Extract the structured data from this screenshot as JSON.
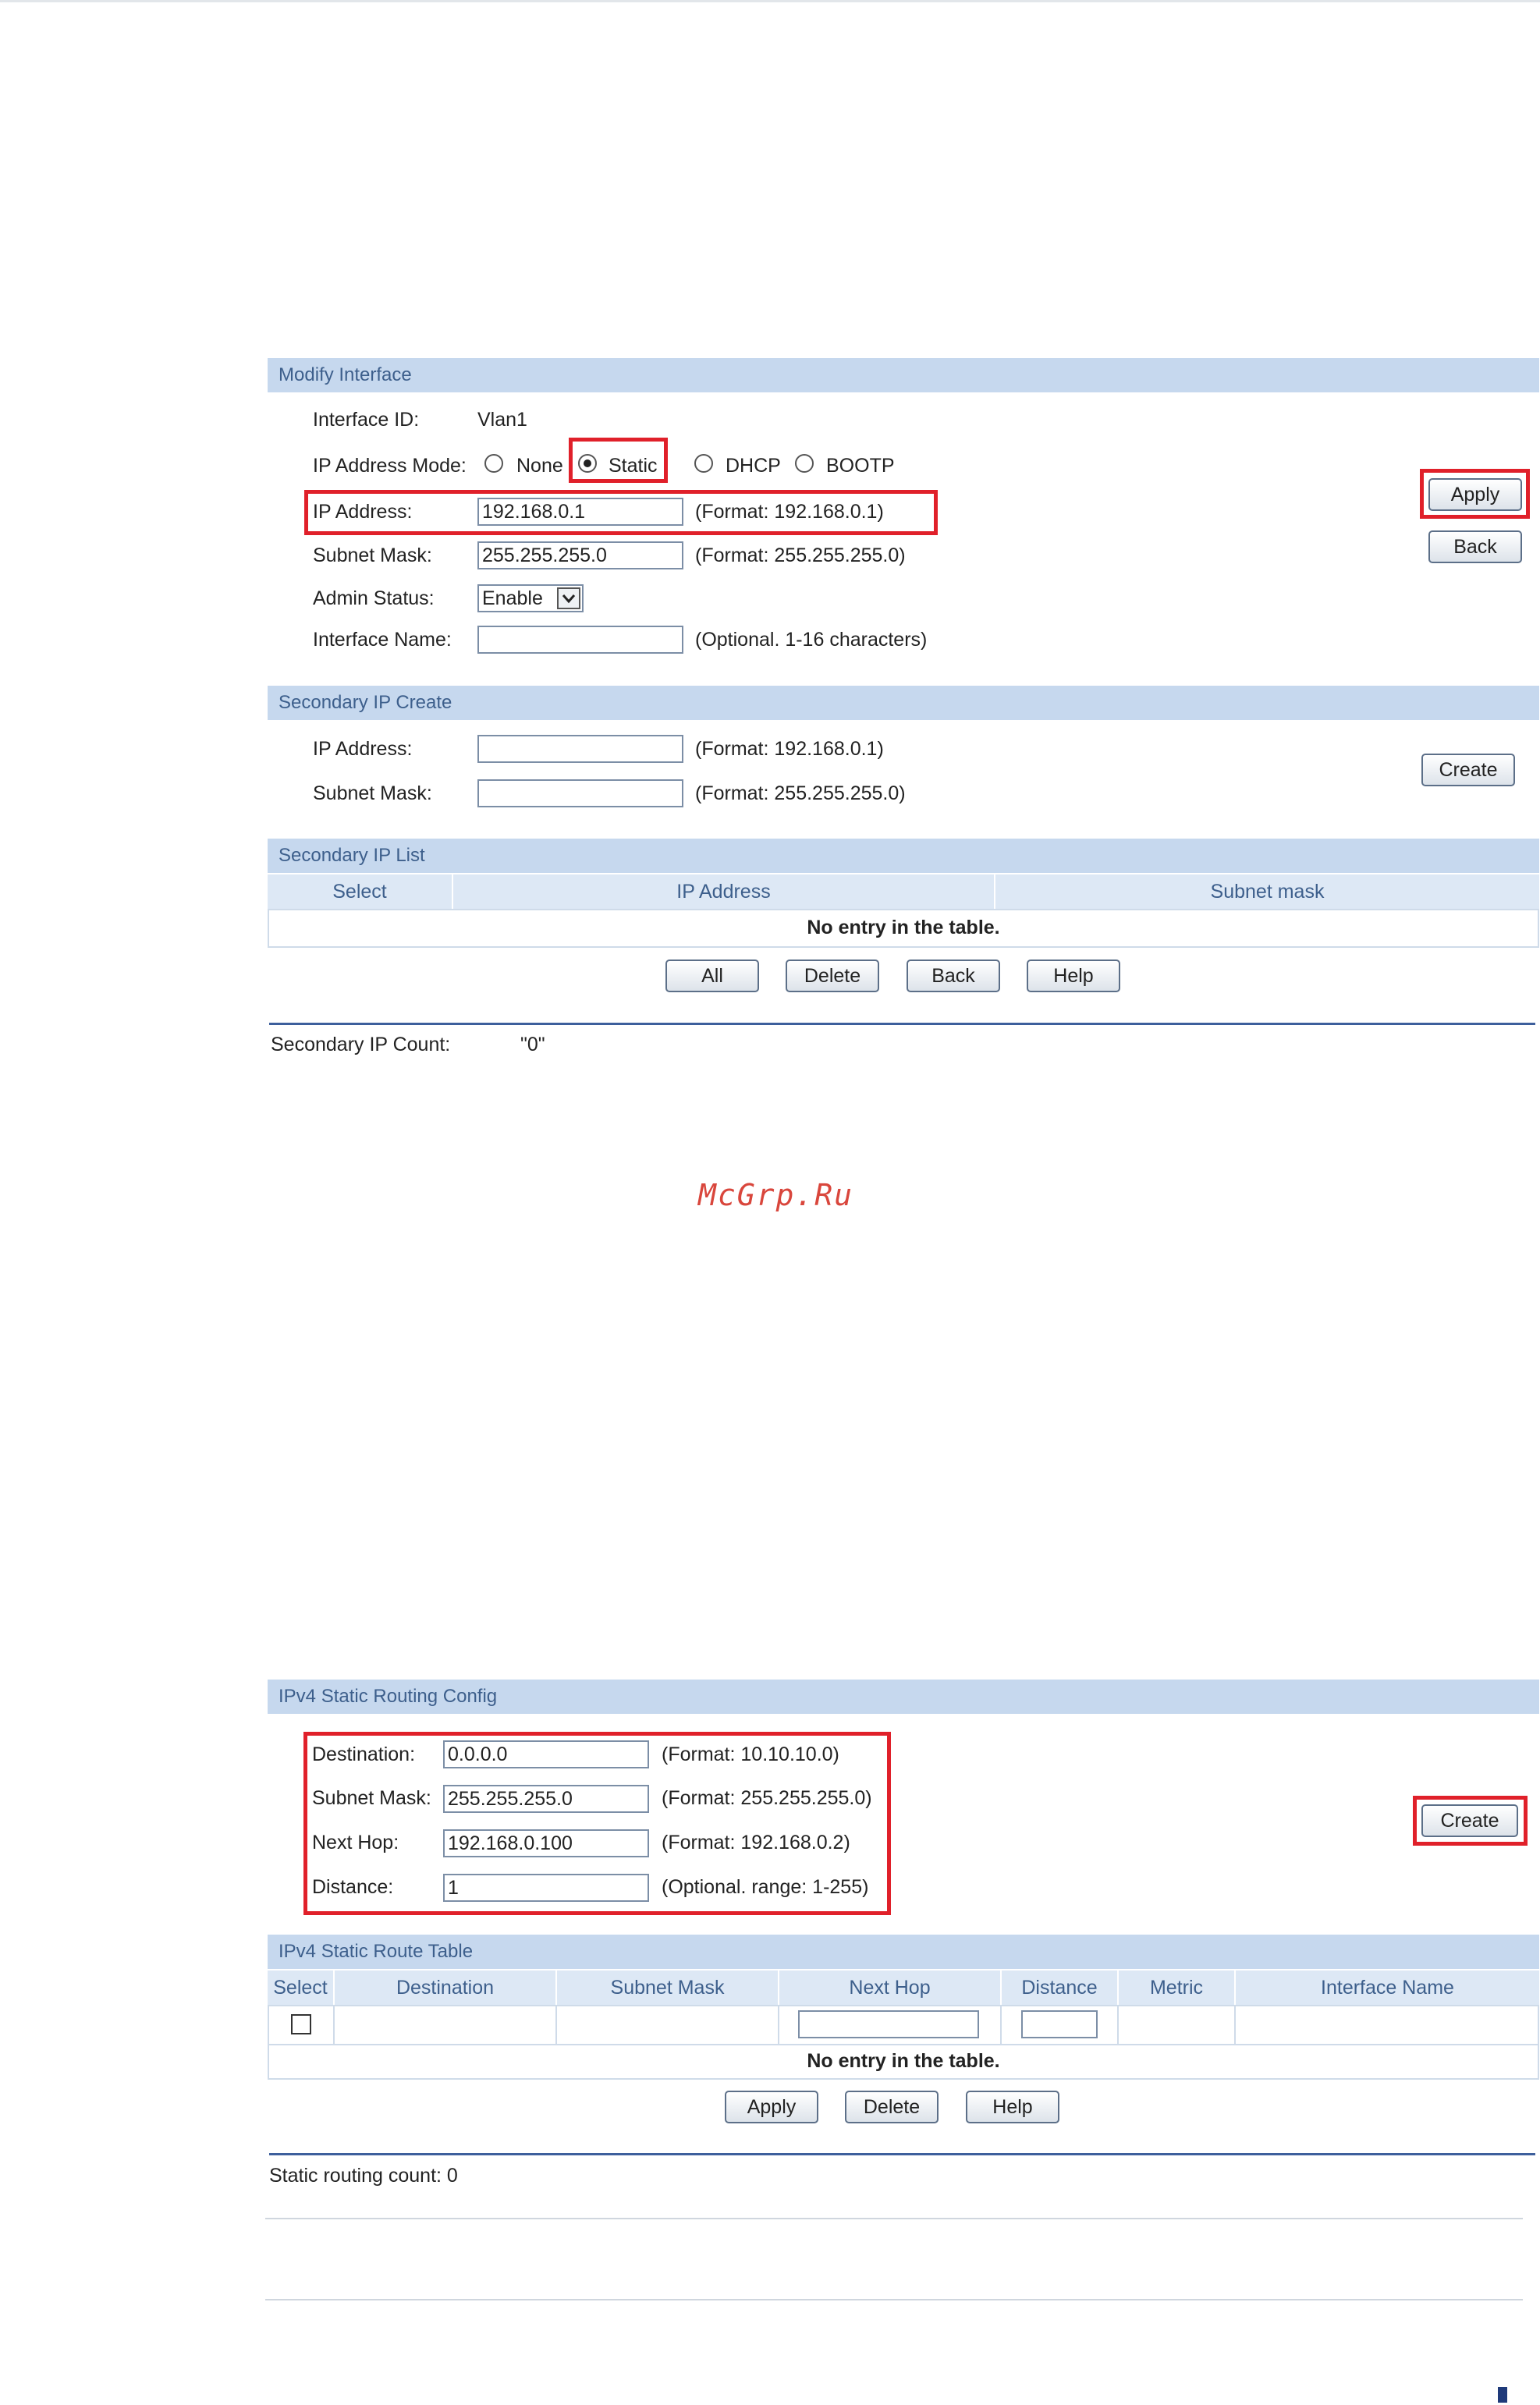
{
  "modify_interface": {
    "title": "Modify Interface",
    "interface_id_label": "Interface ID:",
    "interface_id_value": "Vlan1",
    "ip_mode_label": "IP Address Mode:",
    "mode_none": "None",
    "mode_static": "Static",
    "mode_dhcp": "DHCP",
    "mode_bootp": "BOOTP",
    "selected_mode": "Static",
    "ip_label": "IP Address:",
    "ip_value": "192.168.0.1",
    "ip_hint": "(Format: 192.168.0.1)",
    "mask_label": "Subnet Mask:",
    "mask_value": "255.255.255.0",
    "mask_hint": "(Format: 255.255.255.0)",
    "admin_label": "Admin Status:",
    "admin_value": "Enable",
    "name_label": "Interface Name:",
    "name_value": "",
    "name_hint": "(Optional. 1-16 characters)",
    "apply": "Apply",
    "back": "Back"
  },
  "secondary_create": {
    "title": "Secondary IP Create",
    "ip_label": "IP Address:",
    "ip_value": "",
    "ip_hint": "(Format: 192.168.0.1)",
    "mask_label": "Subnet Mask:",
    "mask_value": "",
    "mask_hint": "(Format: 255.255.255.0)",
    "create": "Create"
  },
  "secondary_list": {
    "title": "Secondary IP List",
    "columns": [
      "Select",
      "IP Address",
      "Subnet mask"
    ],
    "empty": "No entry in the table.",
    "buttons": [
      "All",
      "Delete",
      "Back",
      "Help"
    ],
    "count_label": "Secondary IP Count:",
    "count_value": "\"0\""
  },
  "watermark": "McGrp.Ru",
  "static_routing": {
    "title": "IPv4 Static Routing Config",
    "dest_label": "Destination:",
    "dest_value": "0.0.0.0",
    "dest_hint": "(Format: 10.10.10.0)",
    "mask_label": "Subnet Mask:",
    "mask_value": "255.255.255.0",
    "mask_hint": "(Format: 255.255.255.0)",
    "hop_label": "Next Hop:",
    "hop_value": "192.168.0.100",
    "hop_hint": "(Format: 192.168.0.2)",
    "dist_label": "Distance:",
    "dist_value": "1",
    "dist_hint": "(Optional. range: 1-255)",
    "create": "Create"
  },
  "route_table": {
    "title": "IPv4 Static Route Table",
    "columns": [
      "Select",
      "Destination",
      "Subnet Mask",
      "Next Hop",
      "Distance",
      "Metric",
      "Interface Name"
    ],
    "empty": "No entry in the table.",
    "buttons": [
      "Apply",
      "Delete",
      "Help"
    ],
    "count_text": "Static routing count: 0"
  },
  "colors": {
    "panel_header": "#c6d8ee",
    "header_text": "#3d5f8c",
    "highlight": "#e0202a"
  }
}
